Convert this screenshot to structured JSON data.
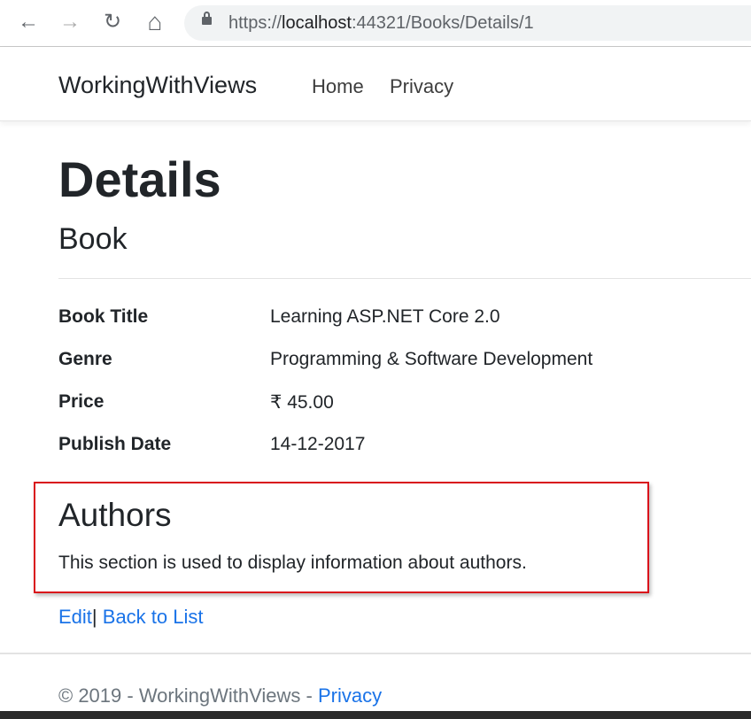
{
  "browser": {
    "url_prefix": "https://",
    "url_host": "localhost",
    "url_rest": ":44321/Books/Details/1",
    "back": "←",
    "forward": "→",
    "reload": "↻",
    "home": "⌂"
  },
  "nav": {
    "brand": "WorkingWithViews",
    "links": [
      "Home",
      "Privacy"
    ]
  },
  "page": {
    "title": "Details",
    "subtitle": "Book",
    "fields": [
      {
        "label": "Book Title",
        "value": "Learning ASP.NET Core 2.0"
      },
      {
        "label": "Genre",
        "value": "Programming & Software Development"
      },
      {
        "label": "Price",
        "value": "₹ 45.00"
      },
      {
        "label": "Publish Date",
        "value": "14-12-2017"
      }
    ],
    "authors": {
      "heading": "Authors",
      "text": "This section is used to display information about authors."
    },
    "actions": {
      "edit": "Edit",
      "separator": "|",
      "back": "Back to List"
    }
  },
  "footer": {
    "text": "© 2019 - WorkingWithViews - ",
    "link": "Privacy"
  },
  "colors": {
    "link": "#1a73e8",
    "highlight": "#d9121b"
  }
}
